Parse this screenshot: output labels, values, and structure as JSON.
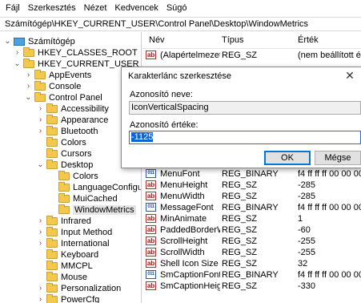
{
  "menu": {
    "items": [
      "Fájl",
      "Szerkesztés",
      "Nézet",
      "Kedvencek",
      "Súgó"
    ]
  },
  "address": "Számítógép\\HKEY_CURRENT_USER\\Control Panel\\Desktop\\WindowMetrics",
  "tree": {
    "items": [
      {
        "label": "Számítógép",
        "arrow": "⌄",
        "icon": "computer"
      },
      {
        "label": "HKEY_CLASSES_ROOT",
        "arrow": "›",
        "icon": "folder"
      },
      {
        "label": "HKEY_CURRENT_USER",
        "arrow": "⌄",
        "icon": "folder"
      },
      {
        "label": "AppEvents",
        "arrow": "›",
        "icon": "folder"
      },
      {
        "label": "Console",
        "arrow": "›",
        "icon": "folder"
      },
      {
        "label": "Control Panel",
        "arrow": "⌄",
        "icon": "folder"
      },
      {
        "label": "Accessibility",
        "arrow": "›",
        "icon": "folder"
      },
      {
        "label": "Appearance",
        "arrow": "›",
        "icon": "folder"
      },
      {
        "label": "Bluetooth",
        "arrow": "›",
        "icon": "folder"
      },
      {
        "label": "Colors",
        "arrow": "",
        "icon": "folder"
      },
      {
        "label": "Cursors",
        "arrow": "",
        "icon": "folder"
      },
      {
        "label": "Desktop",
        "arrow": "⌄",
        "icon": "folder"
      },
      {
        "label": "Colors",
        "arrow": "",
        "icon": "folder"
      },
      {
        "label": "LanguageConfigu",
        "arrow": "",
        "icon": "folder"
      },
      {
        "label": "MuiCached",
        "arrow": "",
        "icon": "folder"
      },
      {
        "label": "WindowMetrics",
        "arrow": "",
        "icon": "folder"
      },
      {
        "label": "Infrared",
        "arrow": "›",
        "icon": "folder"
      },
      {
        "label": "Input Method",
        "arrow": "›",
        "icon": "folder"
      },
      {
        "label": "International",
        "arrow": "›",
        "icon": "folder"
      },
      {
        "label": "Keyboard",
        "arrow": "",
        "icon": "folder"
      },
      {
        "label": "MMCPL",
        "arrow": "",
        "icon": "folder"
      },
      {
        "label": "Mouse",
        "arrow": "",
        "icon": "folder"
      },
      {
        "label": "Personalization",
        "arrow": "›",
        "icon": "folder"
      },
      {
        "label": "PowerCfg",
        "arrow": "›",
        "icon": "folder"
      }
    ]
  },
  "list": {
    "headers": {
      "name": "Név",
      "type": "Típus",
      "value": "Érték"
    },
    "rows": [
      {
        "name": "(Alapértelmezett)",
        "type": "REG_SZ",
        "value": "(nem beállított érté",
        "kind": "ab"
      },
      {
        "name": "MenuFont",
        "type": "REG_BINARY",
        "value": "f4 ff ff ff 00 00 00 0",
        "kind": "bin"
      },
      {
        "name": "MenuHeight",
        "type": "REG_SZ",
        "value": "-285",
        "kind": "ab"
      },
      {
        "name": "MenuWidth",
        "type": "REG_SZ",
        "value": "-285",
        "kind": "ab"
      },
      {
        "name": "MessageFont",
        "type": "REG_BINARY",
        "value": "f4 ff ff ff 00 00 00 0",
        "kind": "bin"
      },
      {
        "name": "MinAnimate",
        "type": "REG_SZ",
        "value": "1",
        "kind": "ab"
      },
      {
        "name": "PaddedBorderW...",
        "type": "REG_SZ",
        "value": "-60",
        "kind": "ab"
      },
      {
        "name": "ScrollHeight",
        "type": "REG_SZ",
        "value": "-255",
        "kind": "ab"
      },
      {
        "name": "ScrollWidth",
        "type": "REG_SZ",
        "value": "-255",
        "kind": "ab"
      },
      {
        "name": "Shell Icon Size",
        "type": "REG_SZ",
        "value": "32",
        "kind": "ab"
      },
      {
        "name": "SmCaptionFont",
        "type": "REG_BINARY",
        "value": "f4 ff ff ff 00 00 00 0",
        "kind": "bin"
      },
      {
        "name": "SmCaptionHeight",
        "type": "REG_SZ",
        "value": "-330",
        "kind": "ab"
      }
    ]
  },
  "dialog": {
    "title": "Karakterlánc szerkesztése",
    "name_label": "Azonosító neve:",
    "name_value": "IconVerticalSpacing",
    "data_label": "Azonosító értéke:",
    "data_value": "-1125",
    "ok_label": "OK",
    "cancel_label": "Mégse",
    "close_glyph": "✕"
  }
}
